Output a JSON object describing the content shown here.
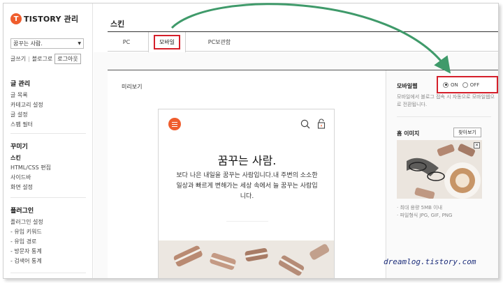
{
  "sidebar": {
    "logo_text": "TISTORY 관리",
    "logo_glyph": "T",
    "blog_select": "꿈꾸는 사람.",
    "account": {
      "write": "글쓰기",
      "blog": "블로그로",
      "logout": "로그아웃"
    },
    "sections": [
      {
        "title": "글 관리",
        "items": [
          "글 목록",
          "카테고리 설정",
          "글 설정",
          "스팸 필터"
        ]
      },
      {
        "title": "꾸미기",
        "items": [
          "스킨",
          "HTML/CSS 편집",
          "사이드바",
          "화면 설정"
        ]
      },
      {
        "title": "플러그인",
        "items": [
          "플러그인 설정",
          "- 유입 키워드",
          "- 유입 경로",
          "- 방문자 통계",
          "- 검색어 통계"
        ]
      }
    ],
    "active_item": "스킨"
  },
  "header": {
    "title": "스킨"
  },
  "tabs": [
    {
      "label": "PC"
    },
    {
      "label": "모바일"
    },
    {
      "label": "PC보관함"
    }
  ],
  "preview": {
    "label": "미리보기",
    "blog_title": "꿈꾸는 사람.",
    "description": "보다 나은 내일을 꿈꾸는 사람입니다.내 주변의 소소한 일상과 빠르게 변해가는 세상 속에서 늘 꿈꾸는 사람입니다."
  },
  "settings": {
    "mobile_web_label": "모바일웹",
    "on_label": "ON",
    "off_label": "OFF",
    "selected": "ON",
    "help": "모바일에서 블로그 접속 시 자동으로 모바일웹으로 전환됩니다.",
    "home_image_label": "홈 이미지",
    "find_button": "찾아보기",
    "close_glyph": "×",
    "spec_size": "최대 용량 5MB 이내",
    "spec_format": "파일형식 JPG, GIF, PNG"
  },
  "watermark": "dreamlog.tistory.com",
  "colors": {
    "accent": "#ef5d2d",
    "highlight": "#d51f2a",
    "arrow": "#3f9a6a"
  }
}
